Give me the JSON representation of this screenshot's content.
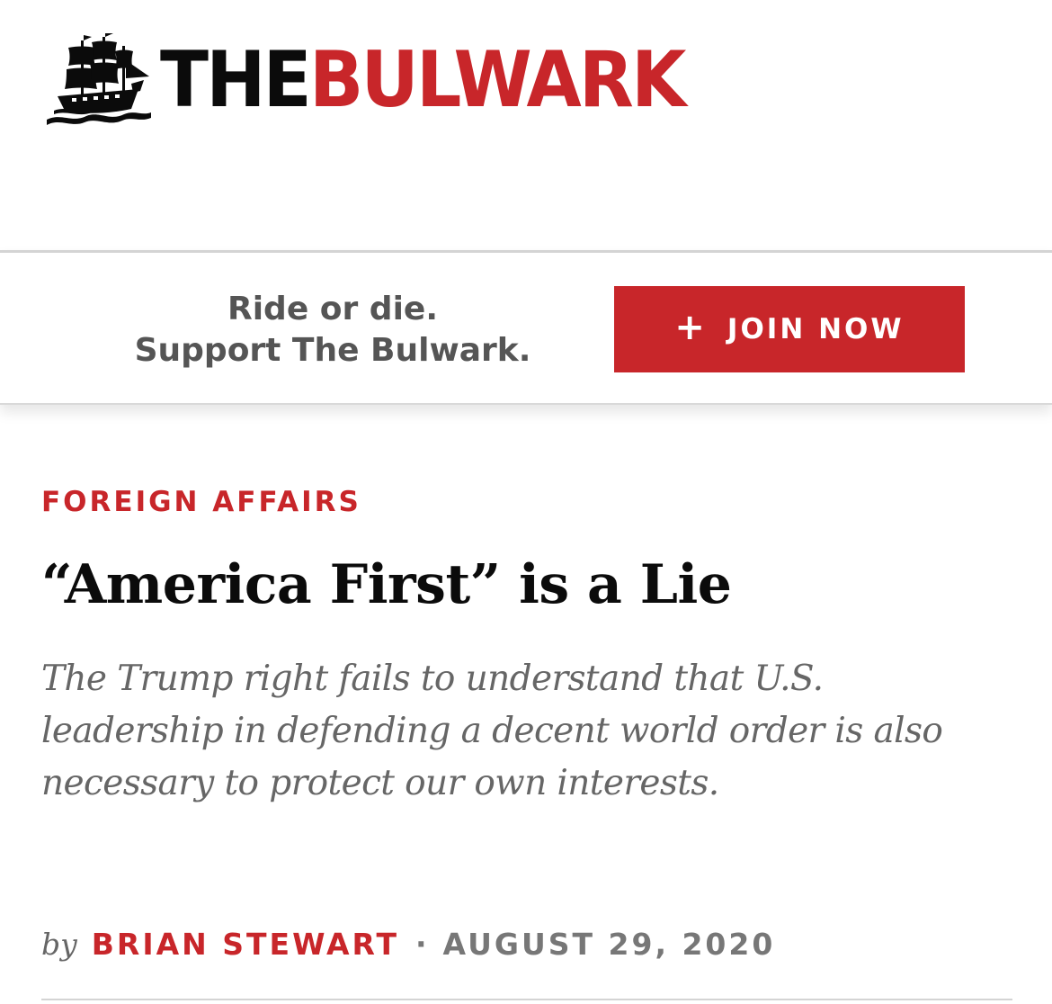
{
  "header": {
    "logo_icon": "ship-icon",
    "logo_the": "THE",
    "logo_bulwark": "BULWARK"
  },
  "banner": {
    "tagline_line1": "Ride or die.",
    "tagline_line2": "Support The Bulwark.",
    "join_icon": "plus-icon",
    "join_plus": "+",
    "join_label": "JOIN NOW"
  },
  "article": {
    "category": "FOREIGN AFFAIRS",
    "headline": "“America First” is a Lie",
    "subhead": "The Trump right fails to understand that U.S. leadership in defending a decent world order is also necessary to protect our own interests.",
    "byline_prefix": "by",
    "author": "BRIAN STEWART",
    "separator": "·",
    "date": "AUGUST 29, 2020"
  },
  "colors": {
    "brand_red": "#c8262a",
    "logo_black": "#0b0b0b",
    "muted_gray": "#666666"
  }
}
